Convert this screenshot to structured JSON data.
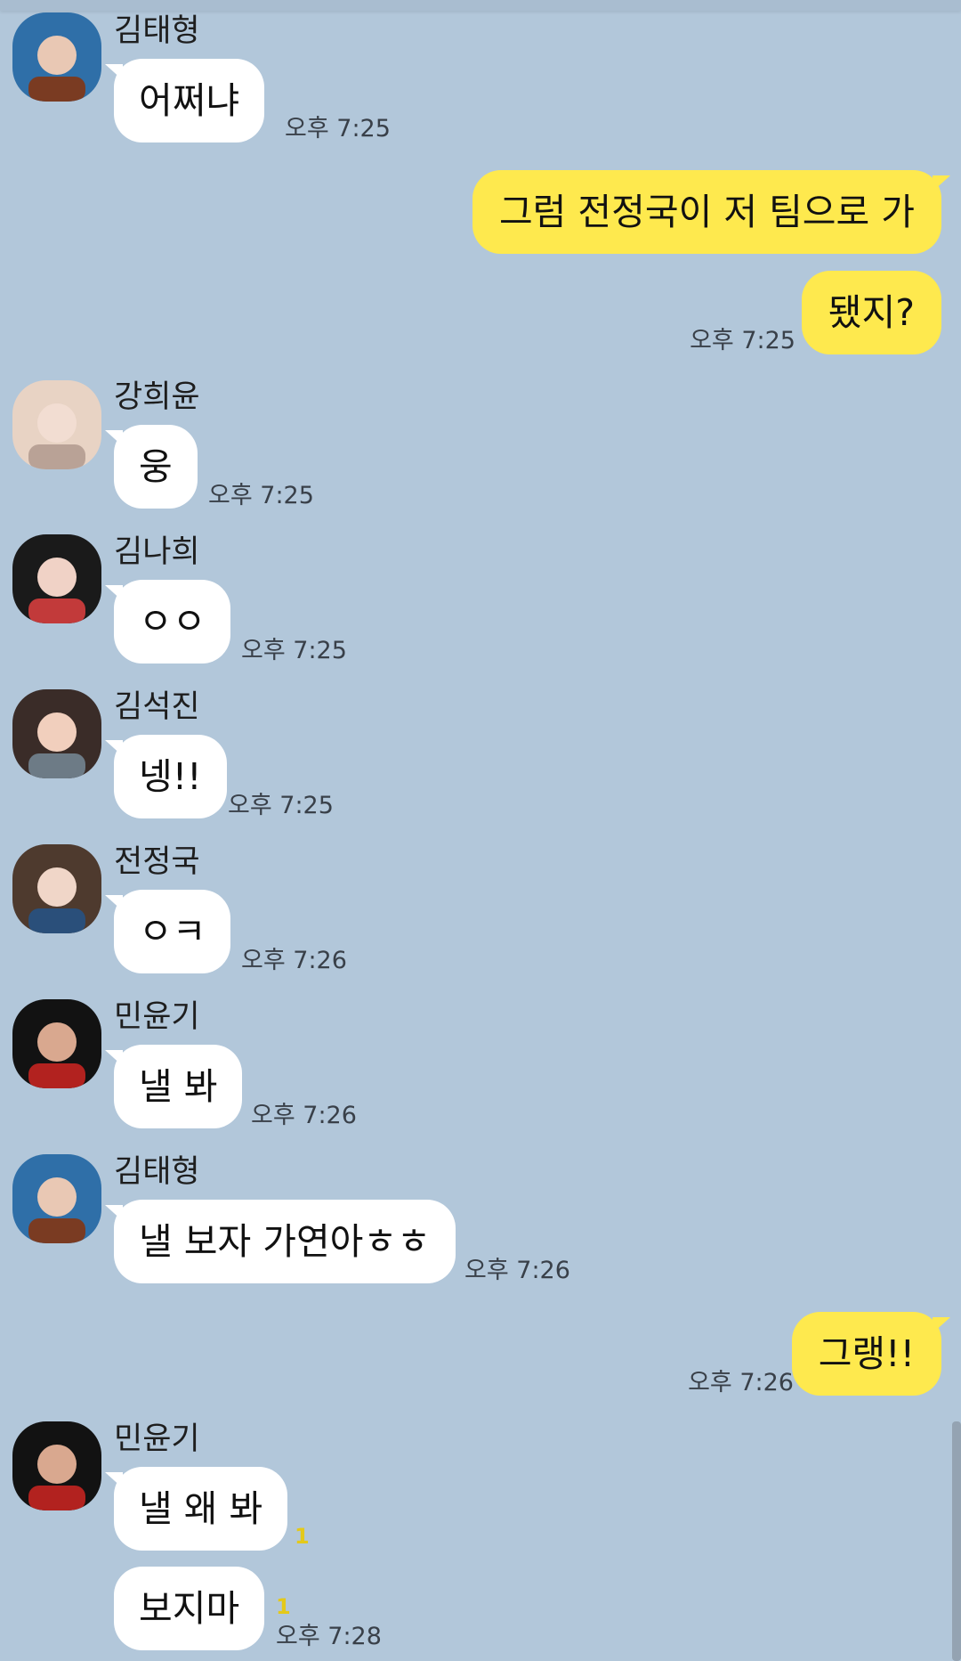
{
  "messages": [
    {
      "sender": "김태형",
      "text": "어쩌냐",
      "time": "오후 7:25"
    },
    {
      "direction": "sent",
      "text": "그럼 전정국이 저 팀으로 가"
    },
    {
      "direction": "sent",
      "text": "됐지?",
      "time": "오후 7:25"
    },
    {
      "sender": "강희윤",
      "text": "웅",
      "time": "오후 7:25"
    },
    {
      "sender": "김나희",
      "text": "ㅇㅇ",
      "time": "오후 7:25"
    },
    {
      "sender": "김석진",
      "text": "넹!!",
      "time": "오후 7:25"
    },
    {
      "sender": "전정국",
      "text": "ㅇㅋ",
      "time": "오후 7:26"
    },
    {
      "sender": "민윤기",
      "text": "낼 봐",
      "time": "오후 7:26"
    },
    {
      "sender": "김태형",
      "text": "낼 보자 가연아ㅎㅎ",
      "time": "오후 7:26"
    },
    {
      "direction": "sent",
      "text": "그랭!!",
      "time": "오후 7:26"
    },
    {
      "sender": "민윤기",
      "text": "낼 왜 봐",
      "unread": "1"
    },
    {
      "text": "보지마",
      "unread": "1",
      "time": "오후 7:28"
    }
  ],
  "colors": {
    "background": "#b2c7da",
    "incoming_bubble": "#ffffff",
    "outgoing_bubble": "#fee94e",
    "unread_count": "#e4c91a"
  },
  "avatars": [
    {
      "icon": "profile-photo-icon",
      "palette": [
        "#2f6fa8",
        "#e9c8b4",
        "#7a3b22"
      ]
    },
    {
      "icon": "profile-photo-icon",
      "palette": [
        "#e8d3c4",
        "#f2ddd2",
        "#b9a296"
      ]
    },
    {
      "icon": "profile-photo-icon",
      "palette": [
        "#1a1a1a",
        "#f0d2c6",
        "#c23a3a"
      ]
    },
    {
      "icon": "profile-photo-icon",
      "palette": [
        "#3a2c28",
        "#f1cfbd",
        "#6d7b86"
      ]
    },
    {
      "icon": "profile-photo-icon",
      "palette": [
        "#4e3a2e",
        "#f0d6c8",
        "#2a4f7a"
      ]
    },
    {
      "icon": "profile-photo-icon",
      "palette": [
        "#121212",
        "#d9a88f",
        "#b2221f"
      ]
    },
    {
      "icon": "profile-photo-icon",
      "palette": [
        "#2f6fa8",
        "#e9c8b4",
        "#7a3b22"
      ]
    },
    {
      "icon": "profile-photo-icon",
      "palette": [
        "#121212",
        "#d9a88f",
        "#b2221f"
      ]
    }
  ]
}
